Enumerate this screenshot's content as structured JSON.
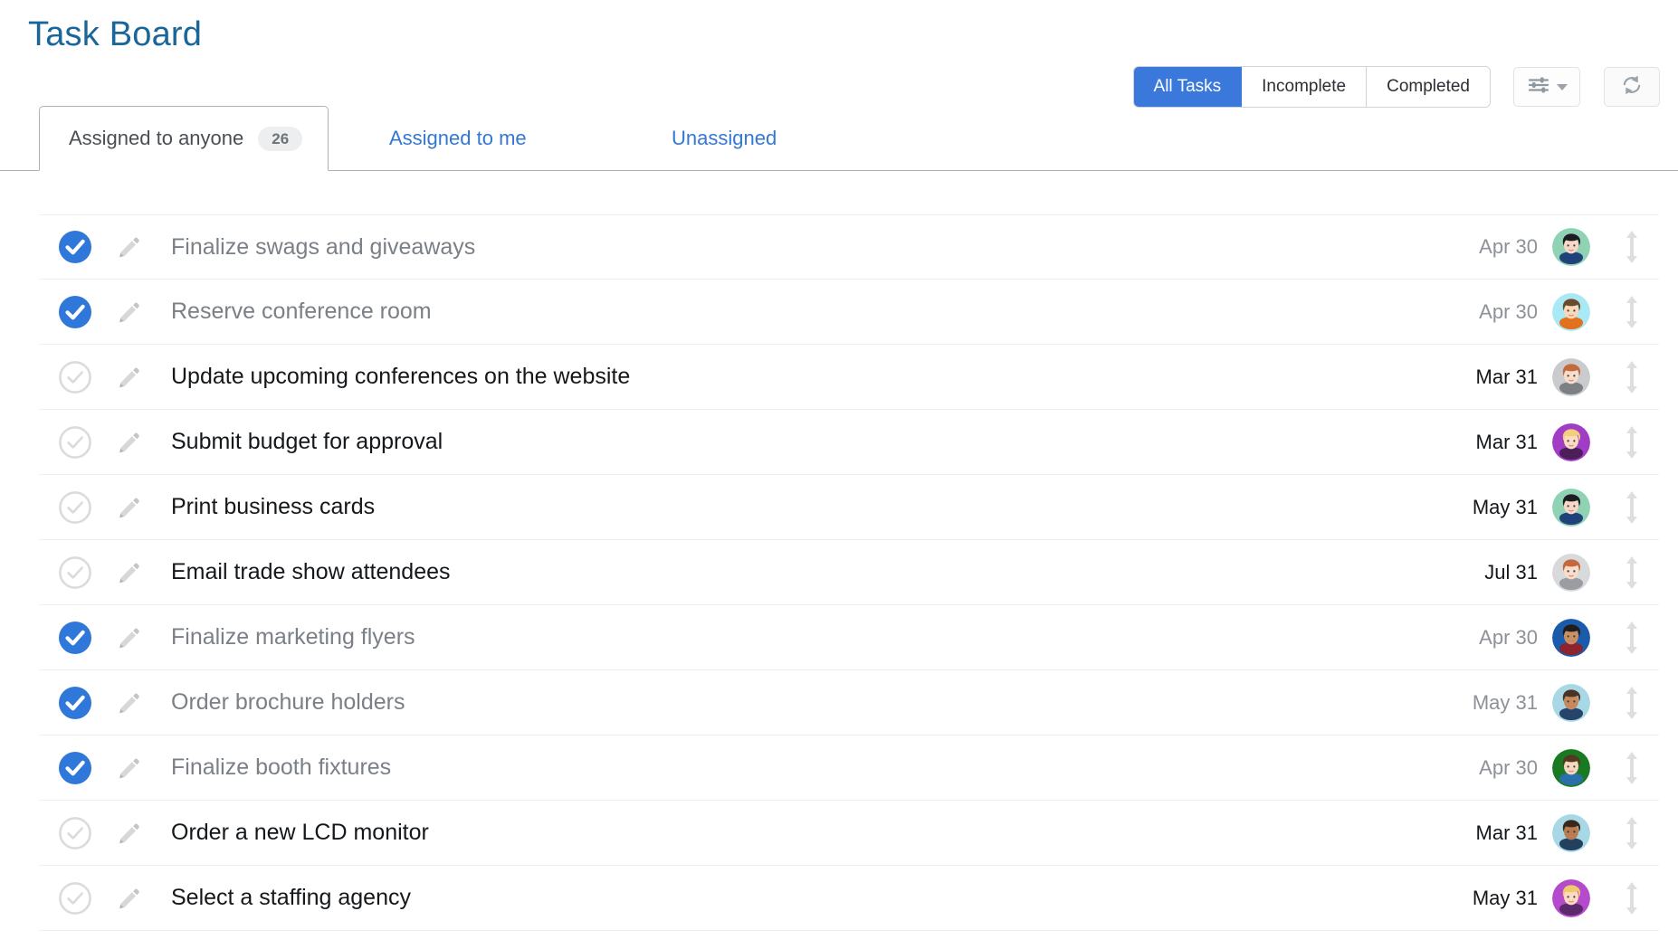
{
  "header": {
    "title": "Task Board",
    "title_color": "#1b6698"
  },
  "filters": {
    "segments": [
      {
        "label": "All Tasks",
        "active": true
      },
      {
        "label": "Incomplete",
        "active": false
      },
      {
        "label": "Completed",
        "active": false
      }
    ],
    "active_color": "#3b78dc",
    "settings_icon": "sliders-icon",
    "settings_caret_icon": "chevron-down-icon",
    "refresh_icon": "refresh-icon"
  },
  "tabs": [
    {
      "label": "Assigned to anyone",
      "badge": "26",
      "active": true
    },
    {
      "label": "Assigned to me",
      "badge": null,
      "active": false
    },
    {
      "label": "Unassigned",
      "badge": null,
      "active": false
    }
  ],
  "tasks": [
    {
      "title": "Finalize swags and giveaways",
      "date": "Apr 30",
      "done": true,
      "avatar": {
        "bg": "#8fd3b4",
        "hair": "#1c1c22",
        "skin": "#f6d7c8",
        "shirt": "#20427a"
      }
    },
    {
      "title": "Reserve conference room",
      "date": "Apr 30",
      "done": true,
      "avatar": {
        "bg": "#a9e9f5",
        "hair": "#6b4a2c",
        "skin": "#fbd9b8",
        "shirt": "#e2711d"
      }
    },
    {
      "title": "Update upcoming conferences on the website",
      "date": "Mar 31",
      "done": false,
      "avatar": {
        "bg": "#c9cbcd",
        "hair": "#c4693b",
        "skin": "#f8ddcb",
        "shirt": "#7c7f84"
      }
    },
    {
      "title": "Submit budget for approval",
      "date": "Mar 31",
      "done": false,
      "avatar": {
        "bg": "#a13cc4",
        "hair": "#f2cf7a",
        "skin": "#fbdcc2",
        "shirt": "#4b2059"
      }
    },
    {
      "title": "Print business cards",
      "date": "May 31",
      "done": false,
      "avatar": {
        "bg": "#8fd3b4",
        "hair": "#1c1c22",
        "skin": "#f6d7c8",
        "shirt": "#20427a"
      }
    },
    {
      "title": "Email trade show attendees",
      "date": "Jul 31",
      "done": false,
      "avatar": {
        "bg": "#d8d9db",
        "hair": "#c4693b",
        "skin": "#f8ddcb",
        "shirt": "#9a9da1"
      }
    },
    {
      "title": "Finalize marketing flyers",
      "date": "Apr 30",
      "done": true,
      "avatar": {
        "bg": "#1a5bab",
        "hair": "#241c18",
        "skin": "#c99064",
        "shirt": "#8e2330"
      }
    },
    {
      "title": "Order brochure holders",
      "date": "May 31",
      "done": true,
      "avatar": {
        "bg": "#a8d7e5",
        "hair": "#4a3224",
        "skin": "#c68a5e",
        "shirt": "#25436b"
      }
    },
    {
      "title": "Finalize booth fixtures",
      "date": "Apr 30",
      "done": true,
      "avatar": {
        "bg": "#1a7a23",
        "hair": "#55391f",
        "skin": "#f6d7c0",
        "shirt": "#2b6fa8"
      }
    },
    {
      "title": "Order a new LCD monitor",
      "date": "Mar 31",
      "done": false,
      "avatar": {
        "bg": "#a8d7e5",
        "hair": "#3a281c",
        "skin": "#b87c50",
        "shirt": "#24405f"
      }
    },
    {
      "title": "Select a staffing agency",
      "date": "May 31",
      "done": false,
      "avatar": {
        "bg": "#b44bcd",
        "hair": "#f0c96d",
        "skin": "#fbdcc2",
        "shirt": "#5a2a6b"
      }
    }
  ],
  "icons": {
    "check_done": "check-circle-filled-icon",
    "check_todo": "check-circle-outline-icon",
    "edit": "pencil-icon",
    "drag": "drag-updown-icon"
  }
}
